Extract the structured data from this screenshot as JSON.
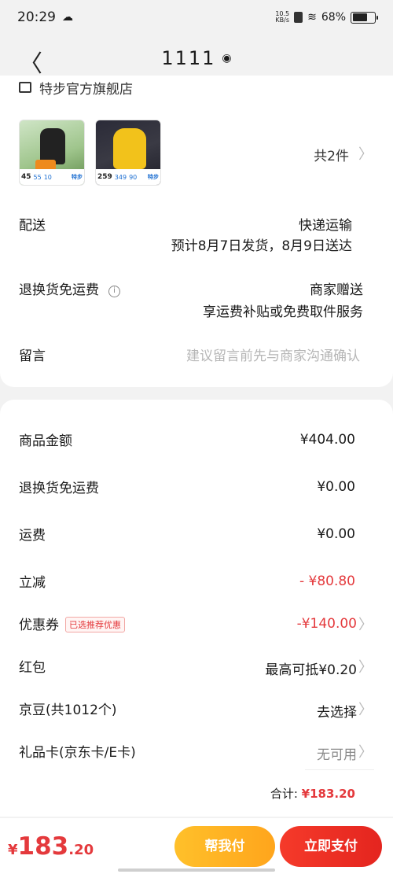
{
  "status": {
    "time": "20:29",
    "net_speed_value": "10.5",
    "net_speed_unit": "KB/s",
    "battery_percent": "68%",
    "battery_level": 0.68
  },
  "nav": {
    "title": "1111"
  },
  "shop": {
    "name": "特步官方旗舰店"
  },
  "products": {
    "items": [
      {
        "price": "45",
        "p2": "55",
        "p3": "10",
        "brand": "特步"
      },
      {
        "price": "259",
        "p2": "349",
        "p3": "90",
        "brand": "特步"
      }
    ],
    "count_label": "共2件"
  },
  "delivery": {
    "label": "配送",
    "method": "快递运输",
    "estimate": "预计8月7日发货，8月9日送达"
  },
  "return_shipping": {
    "label": "退换货免运费",
    "value": "商家赠送",
    "detail": "享运费补贴或免费取件服务"
  },
  "message": {
    "label": "留言",
    "placeholder": "建议留言前先与商家沟通确认"
  },
  "summary": {
    "goods_amount_label": "商品金额",
    "goods_amount": "¥404.00",
    "return_free_label": "退换货免运费",
    "return_free": "¥0.00",
    "shipping_label": "运费",
    "shipping": "¥0.00",
    "discount_label": "立减",
    "discount": "- ¥80.80",
    "coupon_label": "优惠券",
    "coupon_tag": "已选推荐优惠",
    "coupon": "-¥140.00",
    "redpacket_label": "红包",
    "redpacket": "最高可抵¥0.20",
    "jingdou_label": "京豆(共1012个)",
    "jingdou": "去选择",
    "giftcard_label": "礼品卡(京东卡/E卡)",
    "giftcard": "无可用",
    "total_label": "合计:",
    "total": "¥183.20"
  },
  "bottom": {
    "currency": "¥",
    "price_int": "183",
    "price_dec": ".20",
    "help_pay": "帮我付",
    "pay": "立即支付"
  },
  "colors": {
    "accent_red": "#e4393c",
    "help_yellow": "#ffb020"
  }
}
